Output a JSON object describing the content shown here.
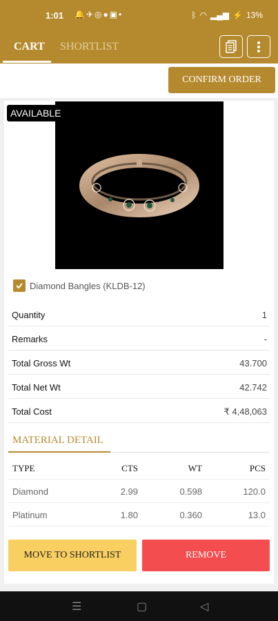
{
  "status": {
    "time": "1:01",
    "battery": "13%"
  },
  "tabs": {
    "cart": "CART",
    "shortlist": "SHORTLIST"
  },
  "actions": {
    "confirm": "CONFIRM ORDER"
  },
  "product": {
    "badge": "AVAILABLE",
    "name": "Diamond Bangles (KLDB-12)",
    "checked": true
  },
  "details": [
    {
      "label": "Quantity",
      "value": "1"
    },
    {
      "label": "Remarks",
      "value": "-"
    },
    {
      "label": "Total Gross Wt",
      "value": "43.700"
    },
    {
      "label": "Total Net Wt",
      "value": "42.742"
    },
    {
      "label": "Total Cost",
      "value": "₹ 4,48,063"
    }
  ],
  "material": {
    "title": "MATERIAL DETAIL",
    "headers": [
      "TYPE",
      "CTS",
      "WT",
      "PCS"
    ],
    "rows": [
      [
        "Diamond",
        "2.99",
        "0.598",
        "120.0"
      ],
      [
        "Platinum",
        "1.80",
        "0.360",
        "13.0"
      ]
    ]
  },
  "buttons": {
    "shortlist": "MOVE TO SHORTLIST",
    "remove": "REMOVE"
  },
  "colors": {
    "brand": "#b58a2e",
    "remove": "#f34d4f",
    "shortlist": "#f8cf60"
  }
}
